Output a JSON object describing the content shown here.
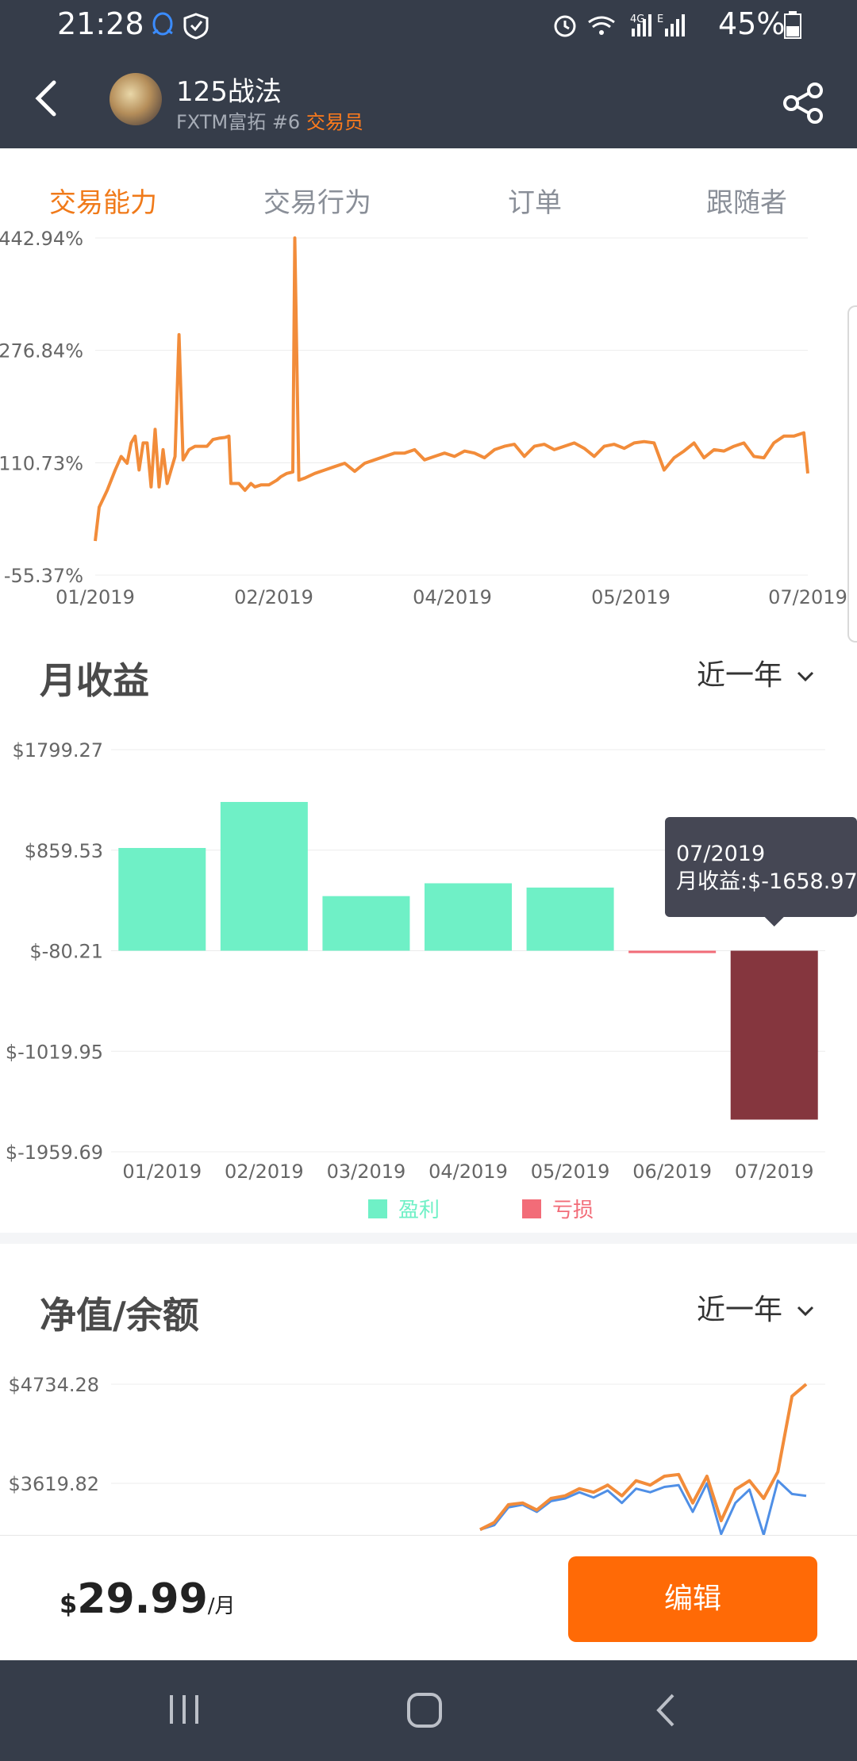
{
  "status_bar": {
    "time": "21:28",
    "battery": "45%",
    "network": "4G",
    "left_icons": [
      "qq-icon",
      "shield-icon"
    ],
    "right_icons": [
      "alarm-icon",
      "wifi-icon",
      "signal-icon",
      "signal-icon",
      "battery-icon"
    ]
  },
  "header": {
    "title": "125战法",
    "subtitle": "FXTM富拓 #6",
    "role_badge": "交易员",
    "accent_color": "#f07a1a"
  },
  "tabs": [
    {
      "label": "交易能力",
      "active": true
    },
    {
      "label": "交易行为",
      "active": false
    },
    {
      "label": "订单",
      "active": false
    },
    {
      "label": "跟随者",
      "active": false
    }
  ],
  "chart_data": [
    {
      "type": "line",
      "title": "",
      "y_ticks": [
        "442.94%",
        "276.84%",
        "110.73%",
        "-55.37%"
      ],
      "x_ticks": [
        "01/2019",
        "02/2019",
        "04/2019",
        "05/2019",
        "07/2019"
      ],
      "ylim": [
        -55.37,
        442.94
      ],
      "series": [
        {
          "color": "#f28c3a",
          "points": [
            [
              0,
              -5
            ],
            [
              0.02,
              45
            ],
            [
              0.06,
              70
            ],
            [
              0.1,
              100
            ],
            [
              0.13,
              120
            ],
            [
              0.16,
              110
            ],
            [
              0.18,
              140
            ],
            [
              0.2,
              150
            ],
            [
              0.22,
              100
            ],
            [
              0.24,
              140
            ],
            [
              0.26,
              140
            ],
            [
              0.28,
              75
            ],
            [
              0.3,
              160
            ],
            [
              0.32,
              75
            ],
            [
              0.34,
              130
            ],
            [
              0.36,
              80
            ],
            [
              0.38,
              100
            ],
            [
              0.4,
              120
            ],
            [
              0.42,
              300
            ],
            [
              0.44,
              115
            ],
            [
              0.47,
              130
            ],
            [
              0.5,
              135
            ],
            [
              0.53,
              135
            ],
            [
              0.56,
              135
            ],
            [
              0.59,
              145
            ],
            [
              0.62,
              147
            ],
            [
              0.65,
              148
            ],
            [
              0.67,
              150
            ],
            [
              0.68,
              80
            ],
            [
              0.72,
              80
            ],
            [
              0.75,
              70
            ],
            [
              0.78,
              80
            ],
            [
              0.8,
              75
            ],
            [
              0.83,
              78
            ],
            [
              0.87,
              78
            ],
            [
              0.91,
              85
            ],
            [
              0.93,
              90
            ],
            [
              0.96,
              95
            ],
            [
              0.99,
              97
            ],
            [
              1.0,
              442.94
            ],
            [
              1.02,
              85
            ],
            [
              1.05,
              88
            ],
            [
              1.1,
              95
            ],
            [
              1.15,
              100
            ],
            [
              1.2,
              105
            ],
            [
              1.25,
              110
            ],
            [
              1.3,
              98
            ],
            [
              1.35,
              110
            ],
            [
              1.4,
              115
            ],
            [
              1.45,
              120
            ],
            [
              1.5,
              125
            ],
            [
              1.55,
              125
            ],
            [
              1.6,
              130
            ],
            [
              1.65,
              115
            ],
            [
              1.7,
              120
            ],
            [
              1.75,
              125
            ],
            [
              1.8,
              120
            ],
            [
              1.85,
              128
            ],
            [
              1.9,
              125
            ],
            [
              1.95,
              118
            ],
            [
              2.0,
              130
            ],
            [
              2.05,
              135
            ],
            [
              2.1,
              138
            ],
            [
              2.15,
              120
            ],
            [
              2.2,
              135
            ],
            [
              2.25,
              138
            ],
            [
              2.3,
              130
            ],
            [
              2.35,
              135
            ],
            [
              2.4,
              140
            ],
            [
              2.45,
              132
            ],
            [
              2.5,
              120
            ],
            [
              2.55,
              135
            ],
            [
              2.6,
              138
            ],
            [
              2.65,
              132
            ],
            [
              2.7,
              140
            ],
            [
              2.75,
              142
            ],
            [
              2.8,
              140
            ],
            [
              2.85,
              100
            ],
            [
              2.9,
              118
            ],
            [
              2.95,
              128
            ],
            [
              3.0,
              140
            ],
            [
              3.05,
              118
            ],
            [
              3.1,
              130
            ],
            [
              3.15,
              128
            ],
            [
              3.2,
              135
            ],
            [
              3.25,
              140
            ],
            [
              3.3,
              120
            ],
            [
              3.35,
              118
            ],
            [
              3.4,
              140
            ],
            [
              3.45,
              150
            ],
            [
              3.5,
              150
            ],
            [
              3.55,
              155
            ],
            [
              3.57,
              95
            ]
          ]
        }
      ]
    },
    {
      "type": "bar",
      "title": "月收益",
      "categories": [
        "01/2019",
        "02/2019",
        "03/2019",
        "04/2019",
        "05/2019",
        "06/2019",
        "07/2019"
      ],
      "values": [
        880,
        1310,
        430,
        550,
        510,
        -60,
        -1658.97
      ],
      "y_ticks": [
        "$1799.27",
        "$859.53",
        "$-80.21",
        "$-1019.95",
        "$-1959.69"
      ],
      "ylim": [
        -1959.69,
        1799.27
      ],
      "legend": [
        {
          "label": "盈利",
          "color": "#6ff0c6"
        },
        {
          "label": "亏损",
          "color": "#f26c78"
        }
      ],
      "highlight_color": "#85363e",
      "tooltip": {
        "date": "07/2019",
        "text": "月收益:$-1658.97"
      }
    },
    {
      "type": "line",
      "title": "净值/余额",
      "y_ticks": [
        "$4734.28",
        "$3619.82"
      ],
      "series": [
        {
          "name": "",
          "color": "#4f8fe6",
          "values": [
            3100,
            3150,
            3350,
            3380,
            3300,
            3420,
            3450,
            3520,
            3460,
            3540,
            3400,
            3560,
            3520,
            3580,
            3600,
            3300,
            3620,
            3050,
            3400,
            3550,
            2800,
            3650,
            3500,
            3480
          ]
        },
        {
          "name": "",
          "color": "#f28c3a",
          "values": [
            3100,
            3180,
            3380,
            3400,
            3320,
            3450,
            3480,
            3560,
            3520,
            3600,
            3480,
            3650,
            3600,
            3700,
            3720,
            3400,
            3700,
            3200,
            3550,
            3650,
            3450,
            3750,
            4600,
            4734
          ]
        }
      ]
    }
  ],
  "sections": {
    "monthly": {
      "title": "月收益",
      "range": "近一年"
    },
    "equity": {
      "title": "净值/余额",
      "range": "近一年"
    }
  },
  "bottom": {
    "currency": "$",
    "price": "29.99",
    "per": "/月",
    "edit_label": "编辑"
  },
  "sysnav": [
    "recent-apps-icon",
    "home-icon",
    "back-icon"
  ]
}
